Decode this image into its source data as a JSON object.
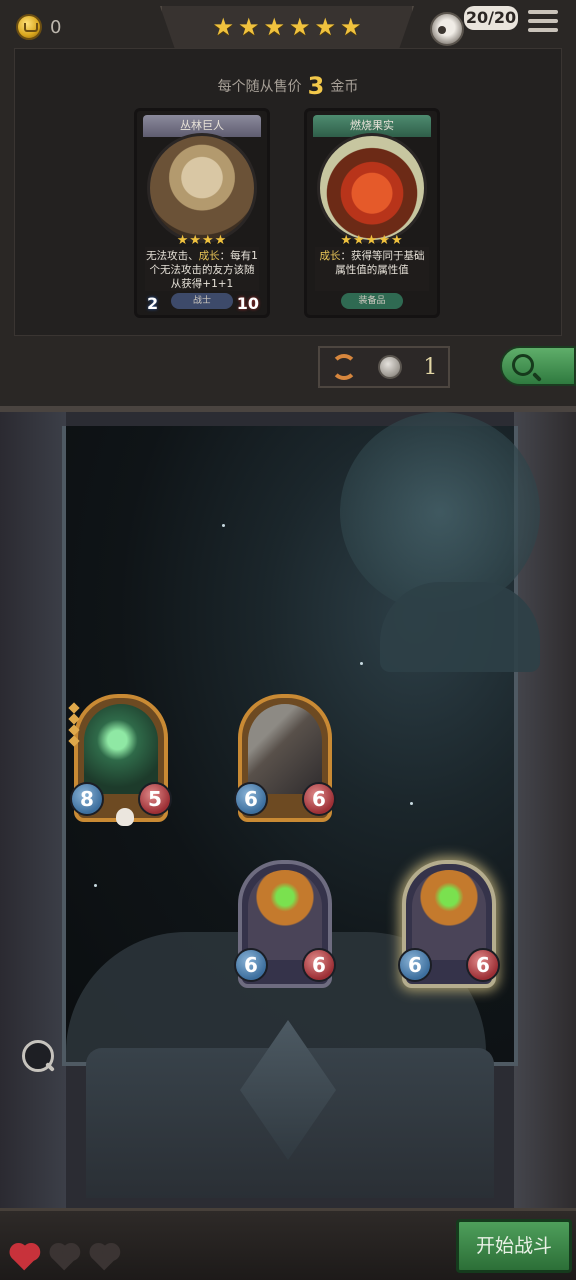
{
  "header": {
    "coins": "0",
    "star_icons": [
      "★",
      "★",
      "★",
      "★",
      "★",
      "★"
    ],
    "population": "20/20",
    "menu_icon": "hamburger-menu-icon"
  },
  "shop": {
    "price_prefix": "每个随从售价",
    "price_value": "3",
    "price_suffix": "金币",
    "cards": [
      {
        "title": "丛林巨人",
        "stars": "★★★★",
        "text_a": "无法攻击、",
        "text_hl": "成长",
        "text_b": "：每有1个无法攻击的友方该随从获得+1+1",
        "tag": "战士",
        "attack": "2",
        "health": "10",
        "accent": "#5f5d70"
      },
      {
        "title": "燃烧果实",
        "stars": "★★★★★",
        "text_a": "",
        "text_hl": "成长",
        "text_b": "：获得等同于基础属性值的属性值",
        "tag": "装备品",
        "accent": "#2f5e49"
      }
    ],
    "reroll_cost": "1"
  },
  "board": {
    "units": [
      {
        "name": "ghost",
        "attack": "8",
        "health": "5",
        "frame": "gold"
      },
      {
        "name": "rocket",
        "attack": "6",
        "health": "6",
        "frame": "gold"
      },
      {
        "name": "pumpkin-knight",
        "attack": "6",
        "health": "6",
        "frame": "silver"
      },
      {
        "name": "pumpkin-knight",
        "attack": "6",
        "health": "6",
        "frame": "silver",
        "selected": true
      }
    ]
  },
  "footer": {
    "hearts": [
      "full",
      "empty",
      "empty"
    ],
    "start_label": "开始战斗"
  },
  "colors": {
    "gold_text": "#f2c84a",
    "start_button": "#4e9f5b",
    "heart_full": "#c8323b"
  }
}
